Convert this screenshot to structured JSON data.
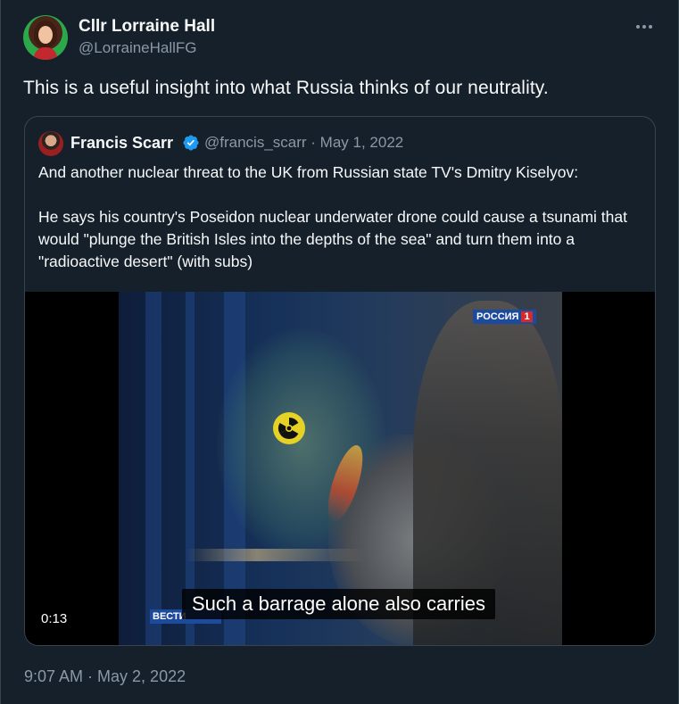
{
  "author": {
    "display_name": "Cllr Lorraine Hall",
    "handle": "@LorraineHallFG"
  },
  "tweet": {
    "text": "This is a useful insight into what Russia thinks of our neutrality.",
    "timestamp": "9:07 AM · May 2, 2022"
  },
  "quoted": {
    "display_name": "Francis Scarr",
    "meta": "@francis_scarr · May 1, 2022",
    "paragraph_1": "And another nuclear threat to the UK from Russian state TV's Dmitry Kiselyov:",
    "paragraph_2": "He says his country's Poseidon nuclear underwater drone could cause a tsunami that would \"plunge the British Isles into the depths of the sea\" and turn them into a \"radioactive desert\" (with subs)"
  },
  "video": {
    "duration": "0:13",
    "subtitle": "Such a barrage alone also carries",
    "channel_logo": "РОССИЯ",
    "channel_number": "1",
    "news_logo": "ВЕСТИ"
  },
  "colors": {
    "background": "#15202b",
    "text": "#f7f9f9",
    "muted": "#8b98a5",
    "border": "#38444d",
    "verified": "#1d9bf0"
  },
  "icons": {
    "more": "more-horizontal-icon",
    "verified": "verified-badge-icon",
    "radiation": "radiation-icon"
  }
}
